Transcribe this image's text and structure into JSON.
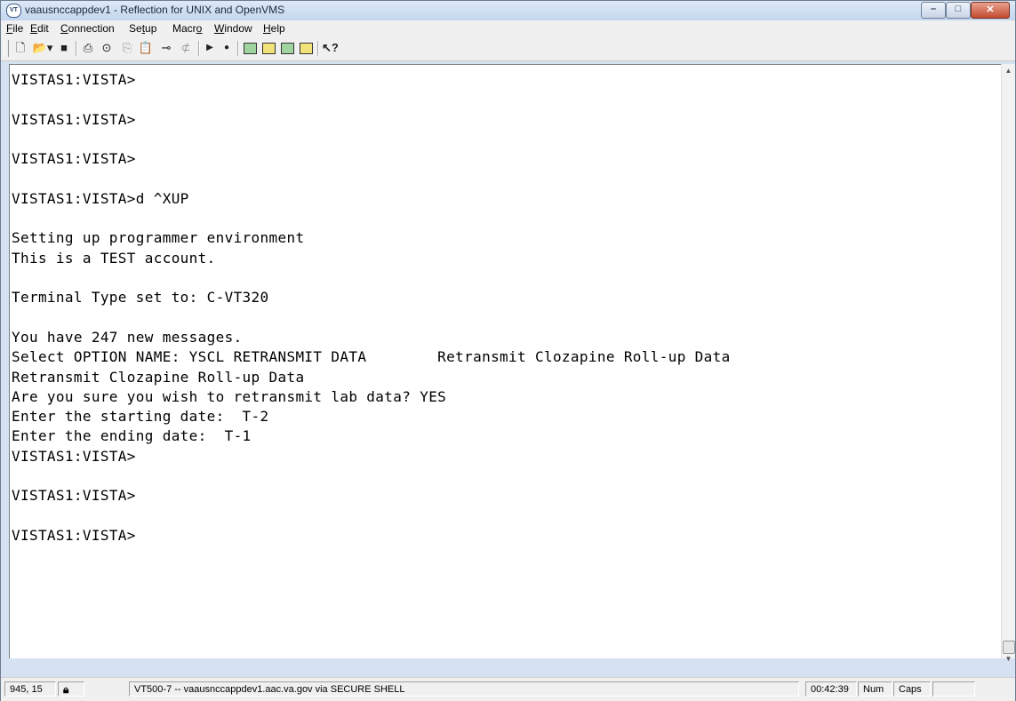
{
  "window": {
    "icon_text": "VT",
    "title": "vaausnccappdev1 - Reflection for UNIX and OpenVMS"
  },
  "menu": {
    "items": [
      {
        "underline": "F",
        "rest": "ile"
      },
      {
        "underline": "E",
        "rest": "dit"
      },
      {
        "underline": "C",
        "rest": "onnection"
      },
      {
        "pre": "Se",
        "underline": "t",
        "rest": "up"
      },
      {
        "pre": "Macr",
        "underline": "o",
        "rest": ""
      },
      {
        "underline": "W",
        "rest": "indow"
      },
      {
        "underline": "H",
        "rest": "elp"
      }
    ]
  },
  "toolbar": {
    "icons": [
      "new-icon",
      "open-icon",
      "save-icon",
      "print-icon",
      "find-icon",
      "copy-icon",
      "paste-icon",
      "connect-icon",
      "disconnect-icon",
      "play-icon",
      "record-icon",
      "panel-1-icon",
      "panel-2-icon",
      "panel-3-icon",
      "panel-4-icon",
      "context-help-icon"
    ]
  },
  "terminal": {
    "lines": [
      "VISTAS1:VISTA>",
      "",
      "VISTAS1:VISTA>",
      "",
      "VISTAS1:VISTA>",
      "",
      "VISTAS1:VISTA>d ^XUP",
      "",
      "Setting up programmer environment",
      "This is a TEST account.",
      "",
      "Terminal Type set to: C-VT320",
      "",
      "You have 247 new messages.",
      "Select OPTION NAME: YSCL RETRANSMIT DATA        Retransmit Clozapine Roll-up Data",
      "Retransmit Clozapine Roll-up Data",
      "Are you sure you wish to retransmit lab data? YES",
      "Enter the starting date:  T-2",
      "Enter the ending date:  T-1",
      "VISTAS1:VISTA>",
      "",
      "VISTAS1:VISTA>",
      "",
      "VISTAS1:VISTA>"
    ]
  },
  "status": {
    "cursor_position": "945, 15",
    "lock_icon": "lock-icon",
    "connection": "VT500-7 -- vaausnccappdev1.aac.va.gov via SECURE SHELL",
    "time": "00:42:39",
    "num": "Num",
    "caps": "Caps"
  }
}
